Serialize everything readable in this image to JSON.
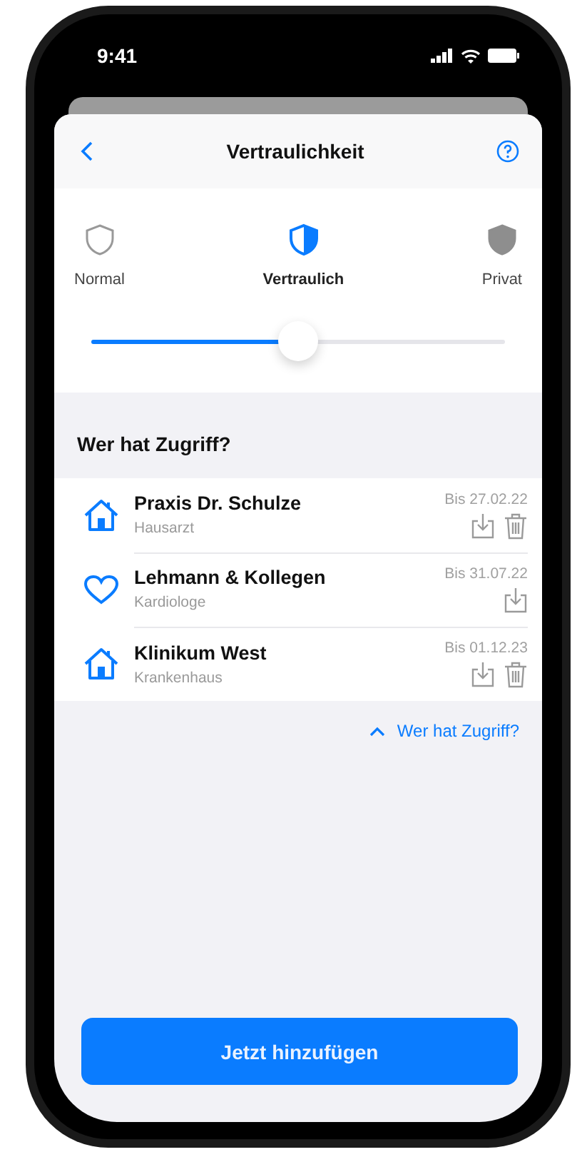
{
  "status_bar": {
    "time": "9:41"
  },
  "header": {
    "title": "Vertraulichkeit"
  },
  "levels": [
    {
      "label": "Normal",
      "kind": "outline",
      "selected": false
    },
    {
      "label": "Vertraulich",
      "kind": "half",
      "selected": true
    },
    {
      "label": "Privat",
      "kind": "filled",
      "selected": false
    }
  ],
  "slider": {
    "level": 0.5
  },
  "section": {
    "title": "Wer hat Zugriff?"
  },
  "access_list": [
    {
      "name": "Praxis Dr. Schulze",
      "subtitle": "Hausarzt",
      "date": "Bis 27.02.22",
      "kind": "house",
      "deletable": true
    },
    {
      "name": "Lehmann & Kollegen",
      "subtitle": "Kardiologe",
      "date": "Bis 31.07.22",
      "kind": "heart",
      "deletable": false
    },
    {
      "name": "Klinikum West",
      "subtitle": "Krankenhaus",
      "date": "Bis 01.12.23",
      "kind": "house",
      "deletable": true
    }
  ],
  "collapse_link": {
    "label": "Wer hat Zugriff?"
  },
  "primary_button": {
    "label": "Jetzt hinzufügen"
  }
}
